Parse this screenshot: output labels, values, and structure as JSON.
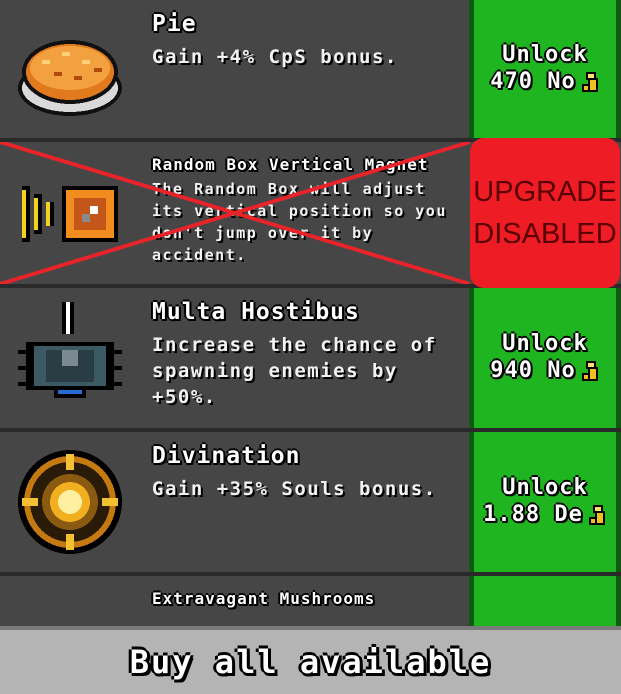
{
  "upgrades": [
    {
      "name": "Pie",
      "description": "Gain +4% CpS bonus.",
      "button_line1": "Unlock",
      "button_line2": "470 No",
      "icon": "pie-icon"
    },
    {
      "name": "Random Box Vertical Magnet",
      "description": "The Random Box will adjust its vertical position so you don't jump over it by accident.",
      "status": "UPGRADE DISABLED",
      "status_line1": "UPGRADE",
      "status_line2": "DISABLED",
      "icon": "magnet-box-icon"
    },
    {
      "name": "Multa Hostibus",
      "description": "Increase the chance of spawning enemies by +50%.",
      "button_line1": "Unlock",
      "button_line2": "940 No",
      "icon": "spider-icon"
    },
    {
      "name": "Divination",
      "description": "Gain +35% Souls bonus.",
      "button_line1": "Unlock",
      "button_line2": "1.88 De",
      "icon": "divination-orb-icon"
    },
    {
      "name": "Extravagant Mushrooms",
      "icon": "mushrooms-icon"
    }
  ],
  "currency_icon": "coin-stack-icon",
  "buy_all_label": "Buy all available",
  "colors": {
    "unlock_green": "#1fb520",
    "disabled_red": "#ee1c24",
    "row_bg": "#464646",
    "bottom_bar": "#b4b4b4"
  }
}
